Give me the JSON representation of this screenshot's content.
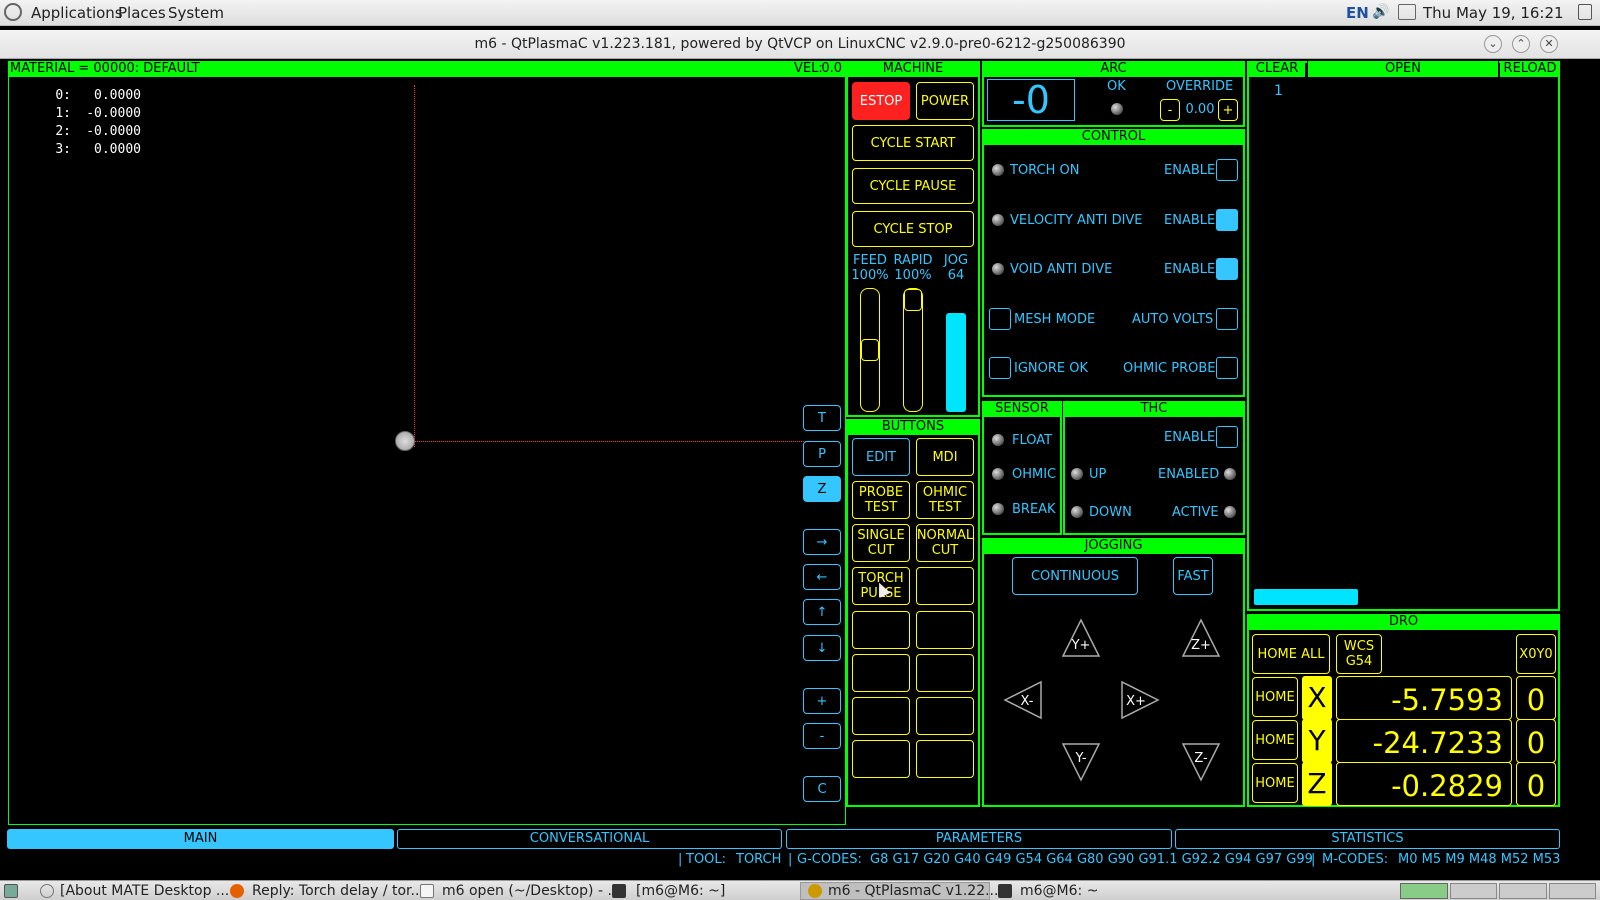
{
  "topbar": {
    "applications": "Applications",
    "places": "Places",
    "system": "System",
    "lang": "EN",
    "clock": "Thu May 19, 16:21"
  },
  "window": {
    "title": "m6 - QtPlasmaC v1.223.181, powered by QtVCP on LinuxCNC v2.9.0-pre0-6212-g250086390"
  },
  "preview": {
    "material": "MATERIAL =  00000: DEFAULT",
    "vel_label": "VEL:",
    "vel_value": "0.0",
    "offsets": [
      {
        "idx": "0:",
        "val": "0.0000"
      },
      {
        "idx": "1:",
        "val": "-0.0000"
      },
      {
        "idx": "2:",
        "val": "-0.0000"
      },
      {
        "idx": "3:",
        "val": "0.0000"
      }
    ],
    "view_buttons": [
      "T",
      "P",
      "Z",
      "→",
      "←",
      "↑",
      "↓",
      "+",
      "-",
      "C"
    ]
  },
  "machine": {
    "header": "MACHINE",
    "estop": "ESTOP",
    "power": "POWER",
    "cycle_start": "CYCLE START",
    "cycle_pause": "CYCLE PAUSE",
    "cycle_stop": "CYCLE STOP",
    "feed_label": "FEED",
    "feed_value": "100%",
    "rapid_label": "RAPID",
    "rapid_value": "100%",
    "jog_label": "JOG",
    "jog_value": "64",
    "feed_level": 0.5,
    "rapid_level": 1.0,
    "jog_level": 0.8
  },
  "buttons": {
    "header": "BUTTONS",
    "edit": "EDIT",
    "mdi": "MDI",
    "probe_test": "PROBE TEST",
    "ohmic_test": "OHMIC TEST",
    "single_cut": "SINGLE CUT",
    "normal_cut": "NORMAL CUT",
    "torch_pulse": "TORCH PULSE"
  },
  "arc": {
    "header": "ARC",
    "voltage": "-0",
    "ok": "OK",
    "override": "OVERRIDE",
    "minus": "-",
    "plus": "+",
    "override_value": "0.00"
  },
  "control": {
    "header": "CONTROL",
    "torch_on": "TORCH ON",
    "vel_anti_dive": "VELOCITY ANTI DIVE",
    "void_anti_dive": "VOID ANTI DIVE",
    "mesh_mode": "MESH MODE",
    "ignore_ok": "IGNORE OK",
    "enable": "ENABLE",
    "auto_volts": "AUTO VOLTS",
    "ohmic_probe": "OHMIC PROBE"
  },
  "sensor": {
    "header": "SENSOR",
    "float": "FLOAT",
    "ohmic": "OHMIC",
    "break": "BREAK"
  },
  "thc": {
    "header": "THC",
    "enable": "ENABLE",
    "up": "UP",
    "down": "DOWN",
    "enabled": "ENABLED",
    "active": "ACTIVE"
  },
  "jogging": {
    "header": "JOGGING",
    "continuous": "CONTINUOUS",
    "fast": "FAST",
    "yplus": "Y+",
    "yminus": "Y-",
    "xplus": "X+",
    "xminus": "X-",
    "zplus": "Z+",
    "zminus": "Z-"
  },
  "gcode": {
    "clear": "CLEAR",
    "open": "OPEN",
    "reload": "RELOAD",
    "line1": "1"
  },
  "dro": {
    "header": "DRO",
    "home_all": "HOME ALL",
    "wcs": "WCS",
    "wcs_value": "G54",
    "x0y0": "X0Y0",
    "home": "HOME",
    "axes": [
      {
        "axis": "X",
        "value": "-5.7593",
        "zero": "0"
      },
      {
        "axis": "Y",
        "value": "-24.7233",
        "zero": "0"
      },
      {
        "axis": "Z",
        "value": "-0.2829",
        "zero": "0"
      }
    ]
  },
  "tabs": {
    "main": "MAIN",
    "conversational": "CONVERSATIONAL",
    "parameters": "PARAMETERS",
    "statistics": "STATISTICS"
  },
  "status": {
    "tool_label": "TOOL:",
    "tool": "TORCH",
    "gcodes_label": "G-CODES:",
    "gcodes": "G8 G17 G20 G40 G49 G54 G64 G80 G90 G91.1 G92.2 G94 G97 G99",
    "mcodes_label": "M-CODES:",
    "mcodes": "M0 M5 M9 M48 M52 M53"
  },
  "taskbar": {
    "items": [
      "[About MATE Desktop ...",
      "Reply: Torch delay / tor...",
      "m6 open (~/Desktop) - ...",
      "[m6@M6: ~]",
      "m6 - QtPlasmaC v1.22...",
      "m6@M6: ~"
    ]
  },
  "colors": {
    "green": "#00ff00",
    "yellow": "#ffff00",
    "cyan": "#35c6ff",
    "estop": "#ff2020"
  }
}
